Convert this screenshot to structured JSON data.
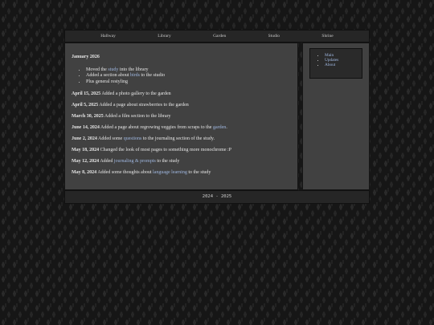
{
  "nav": [
    "Hallway",
    "Library",
    "Garden",
    "Studio",
    "Shrine"
  ],
  "january": {
    "title": "January 2026",
    "items": [
      {
        "pre": "Moved the ",
        "link": "study",
        "post": " into the library"
      },
      {
        "pre": "Added a section about ",
        "link": "birds",
        "post": " to the studio"
      },
      {
        "pre": "Plus general restyling",
        "link": "",
        "post": ""
      }
    ]
  },
  "entries": [
    {
      "date": "April 15, 2025",
      "pre": " Added a photo gallery to the garden",
      "link": "",
      "post": ""
    },
    {
      "date": "April 5, 2025",
      "pre": " Added a page about strawberries to the garden",
      "link": "",
      "post": ""
    },
    {
      "date": "March 30, 2025",
      "pre": " Added a film section to the library",
      "link": "",
      "post": ""
    },
    {
      "date": "June 14, 2024",
      "pre": " Added a page about regrowing veggies from scraps to the ",
      "link": "garden",
      "post": "."
    },
    {
      "date": "June 2, 2024",
      "pre": " Added some ",
      "link": "questions",
      "post": " to the journaling section of the study."
    },
    {
      "date": "May 18, 2024",
      "pre": " Changed the look of most pages to something more monochrome :P",
      "link": "",
      "post": ""
    },
    {
      "date": "May 12, 2024",
      "pre": " Added ",
      "link": "journaling & prompts",
      "post": " to the study"
    },
    {
      "date": "May 8, 2024",
      "pre": " Added some thoughts about ",
      "link": "language learning",
      "post": " to the study"
    }
  ],
  "side": [
    "Main",
    "Updates",
    "About"
  ],
  "footer": "2024 - 2025",
  "colors": {
    "link": "#9fb7e0",
    "panel": "#414141",
    "bar": "#262626"
  }
}
